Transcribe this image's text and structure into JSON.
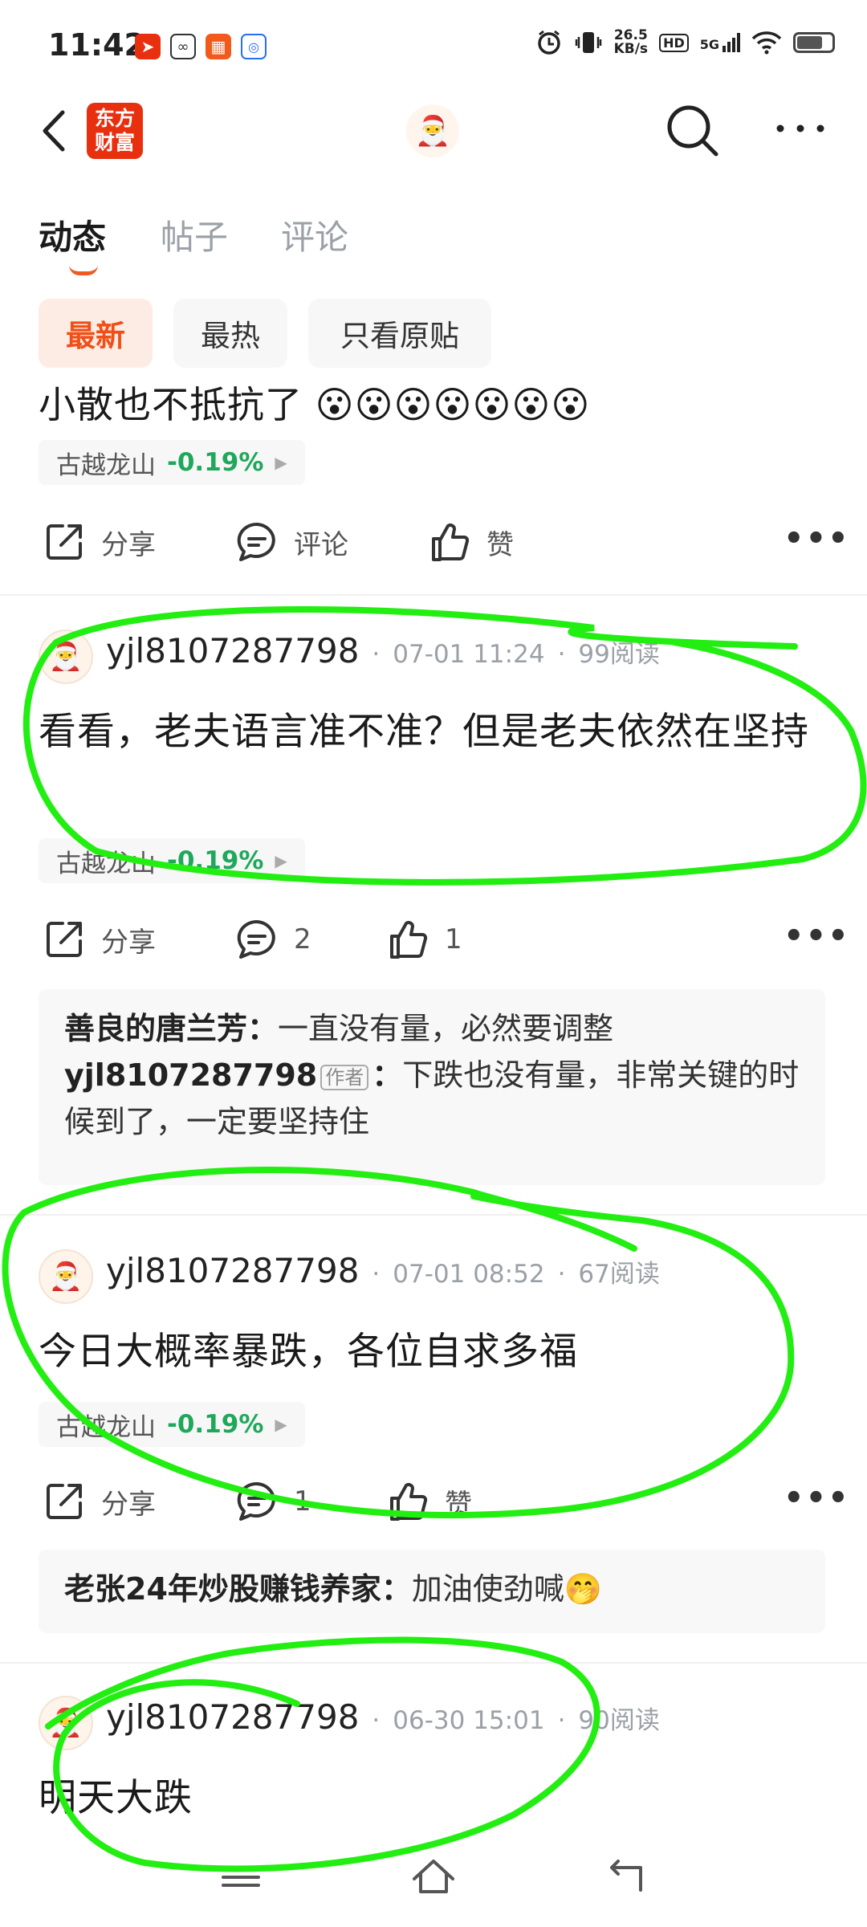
{
  "status_bar": {
    "time": "11:42",
    "net_speed_value": "26.5",
    "net_speed_unit": "KB/s",
    "hd": "HD",
    "signal": "5G",
    "battery_level": 0.75
  },
  "header": {
    "logo_line1": "东方",
    "logo_line2": "财富"
  },
  "tabs": [
    {
      "label": "动态",
      "active": true
    },
    {
      "label": "帖子",
      "active": false
    },
    {
      "label": "评论",
      "active": false
    }
  ],
  "filters": [
    {
      "label": "最新",
      "active": true
    },
    {
      "label": "最热",
      "active": false
    },
    {
      "label": "只看原贴",
      "active": false
    }
  ],
  "partial_post": {
    "text": "小散也不抵抗了",
    "emoji": "😮😮😮😮😮😮😮",
    "stock_name": "古越龙山",
    "stock_change": "-0.19%",
    "share": "分享",
    "comment": "评论",
    "like": "赞"
  },
  "posts": [
    {
      "author": "yjl8107287798",
      "time": "07-01 11:24",
      "reads": "99阅读",
      "body": "看看，老夫语言准不准？但是老夫依然在坚持",
      "stock_name": "古越龙山",
      "stock_change": "-0.19%",
      "share": "分享",
      "comments": "2",
      "likes": "1",
      "replies": [
        {
          "name": "善良的唐兰芳",
          "text": "一直没有量，必然要调整",
          "is_author": false
        },
        {
          "name": "yjl8107287798",
          "badge": "作者",
          "text": "下跌也没有量，非常关键的时候到了，一定要坚持住",
          "is_author": true
        }
      ]
    },
    {
      "author": "yjl8107287798",
      "time": "07-01 08:52",
      "reads": "67阅读",
      "body": "今日大概率暴跌，各位自求多福",
      "stock_name": "古越龙山",
      "stock_change": "-0.19%",
      "share": "分享",
      "comments": "1",
      "likes": "赞",
      "replies": [
        {
          "name": "老张24年炒股赚钱养家",
          "text": "加油使劲喊🤭",
          "is_author": false
        }
      ]
    },
    {
      "author": "yjl8107287798",
      "time": "06-30 15:01",
      "reads": "90阅读",
      "body": "明天大跌"
    }
  ],
  "colors": {
    "accent": "#f04f18",
    "stock_green": "#1fa85a",
    "annotation_green": "#22ee11"
  }
}
